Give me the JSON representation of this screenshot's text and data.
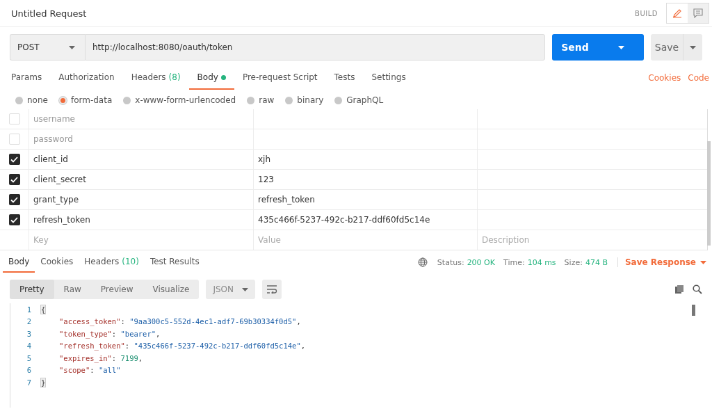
{
  "header": {
    "title": "Untitled Request",
    "build_label": "BUILD",
    "views": [
      {
        "kind": "edit",
        "selected": true
      },
      {
        "kind": "comments",
        "selected": false
      }
    ]
  },
  "request": {
    "method": "POST",
    "url": "http://localhost:8080/oauth/token",
    "send": "Send",
    "save": "Save"
  },
  "tabs": [
    {
      "label": "Params",
      "selected": false,
      "dot": false
    },
    {
      "label": "Authorization",
      "selected": false,
      "dot": false
    },
    {
      "label": "Headers",
      "count": "(8)",
      "selected": false,
      "dot": false
    },
    {
      "label": "Body",
      "selected": true,
      "dot": true
    },
    {
      "label": "Pre-request Script",
      "selected": false,
      "dot": false
    },
    {
      "label": "Tests",
      "selected": false,
      "dot": false
    },
    {
      "label": "Settings",
      "selected": false,
      "dot": false
    }
  ],
  "tab_links": [
    "Cookies",
    "Code"
  ],
  "body_types": [
    {
      "label": "none",
      "selected": false
    },
    {
      "label": "form-data",
      "selected": true
    },
    {
      "label": "x-www-form-urlencoded",
      "selected": false
    },
    {
      "label": "raw",
      "selected": false
    },
    {
      "label": "binary",
      "selected": false
    },
    {
      "label": "GraphQL",
      "selected": false
    }
  ],
  "params": [
    {
      "key": "username",
      "checked": false
    },
    {
      "key": "password",
      "checked": false
    },
    {
      "key": "client_id",
      "value": "xjh",
      "checked": true
    },
    {
      "key": "client_secret",
      "value": "123",
      "checked": true
    },
    {
      "key": "grant_type",
      "value": "refresh_token",
      "checked": true
    },
    {
      "key": "refresh_token",
      "value": "435c466f-5237-492c-b217-ddf60fd5c14e",
      "checked": true
    }
  ],
  "new_param": {
    "key_placeholder": "Key",
    "value_placeholder": "Value",
    "description_placeholder": "Description"
  },
  "response": {
    "tabs": [
      {
        "label": "Body",
        "selected": true
      },
      {
        "label": "Cookies",
        "selected": false
      },
      {
        "label": "Headers",
        "count": "(10)",
        "selected": false
      },
      {
        "label": "Test Results",
        "selected": false
      }
    ],
    "status_label": "Status:",
    "status": "200 OK",
    "time_label": "Time:",
    "time": "104 ms",
    "size_label": "Size:",
    "size": "474 B",
    "save_response": "Save Response",
    "views": [
      {
        "label": "Pretty",
        "selected": true
      },
      {
        "label": "Raw",
        "selected": false
      },
      {
        "label": "Preview",
        "selected": false
      },
      {
        "label": "Visualize",
        "selected": false
      }
    ],
    "format": "JSON",
    "lines": [
      {
        "number": "1",
        "tokens": [
          {
            "kind": "bracket",
            "text": "{"
          }
        ]
      },
      {
        "number": "2",
        "tokens": [
          {
            "kind": "key",
            "text": "\"access_token\""
          },
          {
            "kind": "punct",
            "text": ": "
          },
          {
            "kind": "string",
            "text": "\"9aa300c5-552d-4ec1-adf7-69b30334f0d5\""
          },
          {
            "kind": "punct",
            "text": ","
          }
        ]
      },
      {
        "number": "3",
        "tokens": [
          {
            "kind": "key",
            "text": "\"token_type\""
          },
          {
            "kind": "punct",
            "text": ": "
          },
          {
            "kind": "string",
            "text": "\"bearer\""
          },
          {
            "kind": "punct",
            "text": ","
          }
        ]
      },
      {
        "number": "4",
        "tokens": [
          {
            "kind": "key",
            "text": "\"refresh_token\""
          },
          {
            "kind": "punct",
            "text": ": "
          },
          {
            "kind": "string",
            "text": "\"435c466f-5237-492c-b217-ddf60fd5c14e\""
          },
          {
            "kind": "punct",
            "text": ","
          }
        ]
      },
      {
        "number": "5",
        "tokens": [
          {
            "kind": "key",
            "text": "\"expires_in\""
          },
          {
            "kind": "punct",
            "text": ": "
          },
          {
            "kind": "number",
            "text": "7199"
          },
          {
            "kind": "punct",
            "text": ","
          }
        ]
      },
      {
        "number": "6",
        "tokens": [
          {
            "kind": "key",
            "text": "\"scope\""
          },
          {
            "kind": "punct",
            "text": ": "
          },
          {
            "kind": "string",
            "text": "\"all\""
          }
        ]
      },
      {
        "number": "7",
        "tokens": [
          {
            "kind": "bracket",
            "text": "}"
          }
        ]
      }
    ]
  }
}
